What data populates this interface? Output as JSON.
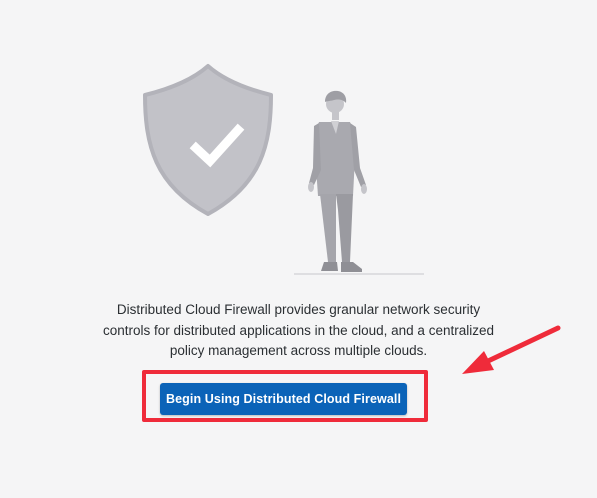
{
  "empty_state": {
    "description_lines": [
      "Distributed Cloud Firewall provides granular network security",
      "controls for distributed applications in the cloud, and a centralized",
      "policy management across multiple clouds."
    ],
    "cta_label": "Begin Using Distributed Cloud Firewall"
  },
  "colors": {
    "cta_background": "#0b63b8",
    "highlight_border": "#ef2b3a",
    "illustration_gray": "#c2c2c8",
    "background": "#f5f5f6"
  },
  "icons": {
    "shield": "shield-check-icon",
    "person": "standing-person-illustration",
    "arrow": "red-pointer-arrow"
  }
}
